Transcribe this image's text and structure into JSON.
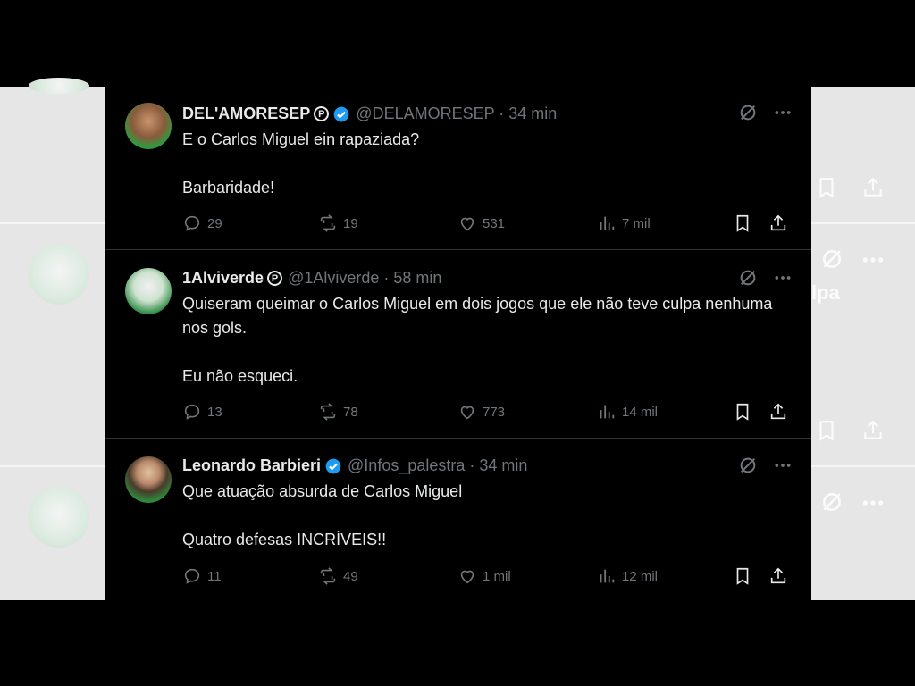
{
  "colors": {
    "background": "#000000",
    "text_primary": "#e7e9ea",
    "text_secondary": "#71767b",
    "verified": "#1d9bf0",
    "side_bg": "#e6e6e6"
  },
  "side_right": {
    "ghost_text": "lpa"
  },
  "tweets": [
    {
      "name": "DEL'AMORESEP",
      "has_p_badge": true,
      "verified": true,
      "handle_time": "@DELAMORESEP · 34 min",
      "text": "E o Carlos Miguel ein rapaziada?\n\nBarbaridade!",
      "replies": "29",
      "retweets": "19",
      "likes": "531",
      "views": "7 mil",
      "avatar_icon": "avatar-photo"
    },
    {
      "name": "1Alviverde",
      "has_p_badge": true,
      "verified": false,
      "handle_time": "@1Alviverde · 58 min",
      "text": "Quiseram queimar o Carlos Miguel em dois jogos que ele não teve culpa nenhuma nos gols.\n\nEu não esqueci.",
      "replies": "13",
      "retweets": "78",
      "likes": "773",
      "views": "14 mil",
      "avatar_icon": "avatar-photo"
    },
    {
      "name": "Leonardo Barbieri",
      "has_p_badge": false,
      "verified": true,
      "handle_time": "@Infos_palestra · 34 min",
      "text": "Que atuação absurda de Carlos Miguel\n\nQuatro defesas INCRÍVEIS!!",
      "replies": "11",
      "retweets": "49",
      "likes": "1 mil",
      "views": "12 mil",
      "avatar_icon": "avatar-photo"
    }
  ],
  "icons": {
    "grok": "grok-icon",
    "more": "more-icon",
    "reply": "reply-icon",
    "retweet": "retweet-icon",
    "like": "heart-icon",
    "views": "views-icon",
    "bookmark": "bookmark-icon",
    "share": "share-icon"
  }
}
